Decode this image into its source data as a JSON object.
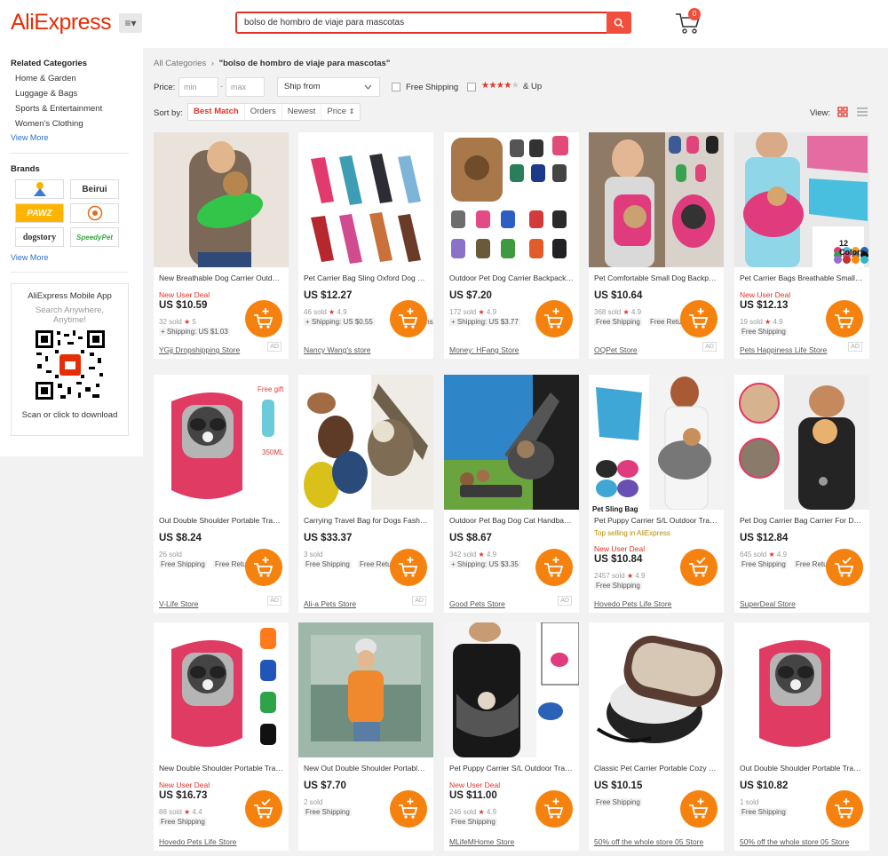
{
  "header": {
    "logo": "AliExpress",
    "menu_glyph": "≡▾",
    "search_value": "bolso de hombro de viaje para mascotas",
    "cart_count": "0",
    "colors": {
      "brand": "#e62e04",
      "accent": "#f24e3c",
      "cart_button": "#f5820e"
    }
  },
  "sidebar": {
    "related_title": "Related Categories",
    "categories": [
      "Home & Garden",
      "Luggage & Bags",
      "Sports & Entertainment",
      "Women's Clothing"
    ],
    "view_more": "View More",
    "brands_title": "Brands",
    "brands": [
      "Beirui",
      "PAWZ",
      "dogstory",
      "SpeedyPet"
    ],
    "brands_view_more": "View More",
    "app_title": "AliExpress Mobile App",
    "app_tagline": "Search Anywhere, Anytime!",
    "app_cta": "Scan or click to download"
  },
  "breadcrumb": {
    "root": "All Categories",
    "sep": "›",
    "query": "\"bolso de hombro de viaje para mascotas\""
  },
  "filters": {
    "price_label": "Price:",
    "min_placeholder": "min",
    "max_placeholder": "max",
    "ship_from": "Ship from",
    "free_shipping": "Free Shipping",
    "rating_label": "& Up"
  },
  "sort": {
    "label": "Sort by:",
    "options": [
      "Best Match",
      "Orders",
      "Newest",
      "Price"
    ],
    "view_label": "View:"
  },
  "products": [
    {
      "title": "New Breathable Dog Carrier Outdoor Pet Sling Bag",
      "badge": "New User Deal",
      "price": "US $10.59",
      "sold": "32 sold",
      "rating": "5",
      "shipping": "+ Shipping: US $1.03",
      "store": "YGjj Dropshipping Store",
      "ad": "AD"
    },
    {
      "title": "Pet Carrier Bag Sling Oxford Dog Carrier",
      "price": "US $12.27",
      "sold": "46 sold",
      "rating": "4.9",
      "shipping": "+ Shipping: US $0.55",
      "shipping2": "Free Returns",
      "store": "Nancy Wang's store"
    },
    {
      "title": "Outdoor Pet Dog Carrier Backpack Travel Bag",
      "price": "US $7.20",
      "sold": "172 sold",
      "rating": "4.9",
      "shipping": "+ Shipping: US $3.77",
      "store": "Money: HFang Store"
    },
    {
      "title": "Pet Comfortable Small Dog Backpack Carrier",
      "price": "US $10.64",
      "sold": "368 sold",
      "rating": "4.9",
      "shipping": "Free Shipping",
      "shipping2": "Free Returns",
      "store": "OQPet Store",
      "ad": "AD"
    },
    {
      "title": "Pet Carrier Bags Breathable Small Dog Sling",
      "badge": "New User Deal",
      "price": "US $12.13",
      "sold": "19 sold",
      "rating": "4.9",
      "shipping": "Free Shipping",
      "store": "Pets Happiness Life Store",
      "ad": "AD",
      "img_text": "12 Colors"
    },
    {
      "title": "Out Double Shoulder Portable Travel Backpack",
      "price": "US $8.24",
      "sold": "26 sold",
      "shipping": "Free Shipping",
      "shipping2": "Free Returns",
      "store": "V-Life Store",
      "ad": "AD",
      "img_text": "Free gift",
      "img_text2": "350ML"
    },
    {
      "title": "Carrying Travel Bag for Dogs Fashion Shoulder",
      "price": "US $33.37",
      "sold": "3 sold",
      "shipping": "Free Shipping",
      "shipping2": "Free Returns",
      "store": "Ali-a Pets Store",
      "ad": "AD"
    },
    {
      "title": "Outdoor Pet Bag Dog Cat Handbag Sling",
      "price": "US $8.67",
      "sold": "342 sold",
      "rating": "4.9",
      "shipping": "+ Shipping: US $3.35",
      "store": "Good Pets Store",
      "ad": "AD"
    },
    {
      "title": "Pet Puppy Carrier S/L Outdoor Travel Dog Bag",
      "top": "Top selling in AliExpress",
      "badge": "New User Deal",
      "price": "US $10.84",
      "sold": "2457 sold",
      "rating": "4.9",
      "shipping": "Free Shipping",
      "store": "Hovedo Pets Life Store",
      "img_text": "Pet Sling Bag"
    },
    {
      "title": "Pet Dog Carrier Bag Carrier For Dogs Backpack",
      "price": "US $12.84",
      "sold": "645 sold",
      "rating": "4.9",
      "shipping": "Free Shipping",
      "shipping2": "Free Returns",
      "store": "SuperDeal Store"
    },
    {
      "title": "New Double Shoulder Portable Travel Backpack",
      "badge": "New User Deal",
      "price": "US $16.73",
      "sold": "88 sold",
      "rating": "4.4",
      "shipping": "Free Shipping",
      "store": "Hovedo Pets Life Store"
    },
    {
      "title": "New Out Double Shoulder Portable Travel Bag",
      "price": "US $7.70",
      "sold": "2 sold",
      "shipping": "Free Shipping",
      "store": ""
    },
    {
      "title": "Pet Puppy Carrier S/L Outdoor Travel Dog Sling",
      "badge": "New User Deal",
      "price": "US $11.00",
      "sold": "246 sold",
      "rating": "4.9",
      "shipping": "Free Shipping",
      "store": "MLifeMHome Store"
    },
    {
      "title": "Classic Pet Carrier Portable Cozy Soft Puppy Bag",
      "price": "US $10.15",
      "shipping": "Free Shipping",
      "store": "50% off the whole store 05 Store"
    },
    {
      "title": "Out Double Shoulder Portable Travel Backpack",
      "price": "US $10.82",
      "sold": "1 sold",
      "shipping": "Free Shipping",
      "store": "50% off the whole store 05 Store"
    }
  ]
}
